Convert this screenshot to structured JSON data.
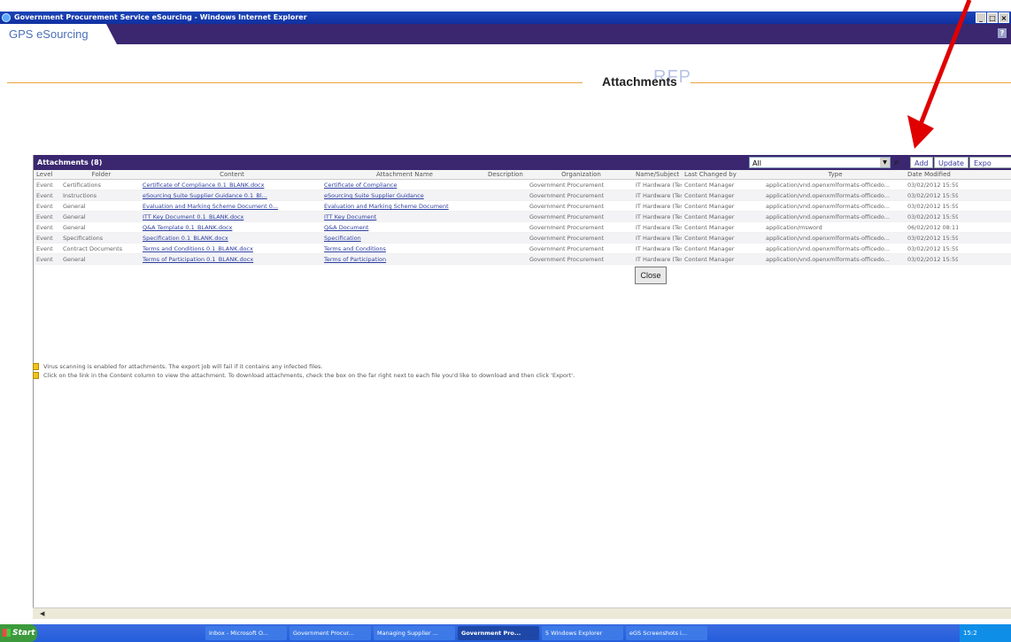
{
  "window": {
    "title": "Government Procurement Service eSourcing - Windows Internet Explorer",
    "controls": [
      "_",
      "□",
      "×"
    ]
  },
  "banner": {
    "logo": "GPS eSourcing",
    "help": "?"
  },
  "page": {
    "section_label": "RFP",
    "title": "Attachments"
  },
  "panel": {
    "header": "Attachments (8)",
    "filter_value": "All",
    "buttons": {
      "add": "Add",
      "update": "Update",
      "export": "Expo"
    },
    "columns": [
      "Level",
      "Folder",
      "Content",
      "Attachment Name",
      "Description",
      "Organization",
      "Name/Subject",
      "Last Changed by",
      "Type",
      "Date Modified"
    ],
    "rows": [
      {
        "level": "Event",
        "folder": "Certifications",
        "content": "Certificate of Compliance 0.1_BLANK.docx",
        "attachment": "Certificate of Compliance",
        "description": "",
        "org": "Government Procurement",
        "name": "IT Hardware (Test)",
        "changed": "Content Manager",
        "type": "application/vnd.openxmlformats-officedo...",
        "date": "03/02/2012 15:59"
      },
      {
        "level": "Event",
        "folder": "Instructions",
        "content": "eSourcing Suite Supplier Guidance 0.1_Bl...",
        "attachment": "eSourcing Suite Supplier Guidance",
        "description": "",
        "org": "Government Procurement",
        "name": "IT Hardware (Test)",
        "changed": "Content Manager",
        "type": "application/vnd.openxmlformats-officedo...",
        "date": "03/02/2012 15:59"
      },
      {
        "level": "Event",
        "folder": "General",
        "content": "Evaluation and Marking Scheme Document 0...",
        "attachment": "Evaluation and Marking Scheme Document",
        "description": "",
        "org": "Government Procurement",
        "name": "IT Hardware (Test)",
        "changed": "Content Manager",
        "type": "application/vnd.openxmlformats-officedo...",
        "date": "03/02/2012 15:59"
      },
      {
        "level": "Event",
        "folder": "General",
        "content": "ITT Key Document 0.1_BLANK.docx",
        "attachment": "ITT Key Document",
        "description": "",
        "org": "Government Procurement",
        "name": "IT Hardware (Test)",
        "changed": "Content Manager",
        "type": "application/vnd.openxmlformats-officedo...",
        "date": "03/02/2012 15:59"
      },
      {
        "level": "Event",
        "folder": "General",
        "content": "Q&A Template 0.1_BLANK.docx",
        "attachment": "Q&A Document",
        "description": "",
        "org": "Government Procurement",
        "name": "IT Hardware (Test)",
        "changed": "Content Manager",
        "type": "application/msword",
        "date": "06/02/2012 08:11"
      },
      {
        "level": "Event",
        "folder": "Specifications",
        "content": "Specification 0.1_BLANK.docx",
        "attachment": "Specification",
        "description": "",
        "org": "Government Procurement",
        "name": "IT Hardware (Test)",
        "changed": "Content Manager",
        "type": "application/vnd.openxmlformats-officedo...",
        "date": "03/02/2012 15:59"
      },
      {
        "level": "Event",
        "folder": "Contract Documents",
        "content": "Terms and Conditions 0.1_BLANK.docx",
        "attachment": "Terms and Conditions",
        "description": "",
        "org": "Government Procurement",
        "name": "IT Hardware (Test)",
        "changed": "Content Manager",
        "type": "application/vnd.openxmlformats-officedo...",
        "date": "03/02/2012 15:59"
      },
      {
        "level": "Event",
        "folder": "General",
        "content": "Terms of Participation 0.1_BLANK.docx",
        "attachment": "Terms of Participation",
        "description": "",
        "org": "Government Procurement",
        "name": "IT Hardware (Test)",
        "changed": "Content Manager",
        "type": "application/vnd.openxmlformats-officedo...",
        "date": "03/02/2012 15:59"
      }
    ],
    "close": "Close"
  },
  "notes": [
    "Virus scanning is enabled for attachments. The export job will fail if it contains any infected files.",
    "Click on the link in the Content column to view the attachment. To download attachments, check the box on the far right next to each file you'd like to download and then click 'Export'."
  ],
  "taskbar": {
    "start": "Start",
    "items": [
      "Inbox - Microsoft O...",
      "Government Procur...",
      "Managing Supplier ...",
      "Government Pro...",
      "5 Windows Explorer",
      "eGS Screenshots i..."
    ],
    "active_index": 3,
    "tray": "15:2"
  },
  "colors": {
    "accent_purple": "#3a2770",
    "rule_orange": "#e8a33c",
    "annotation_red": "#e00000"
  }
}
